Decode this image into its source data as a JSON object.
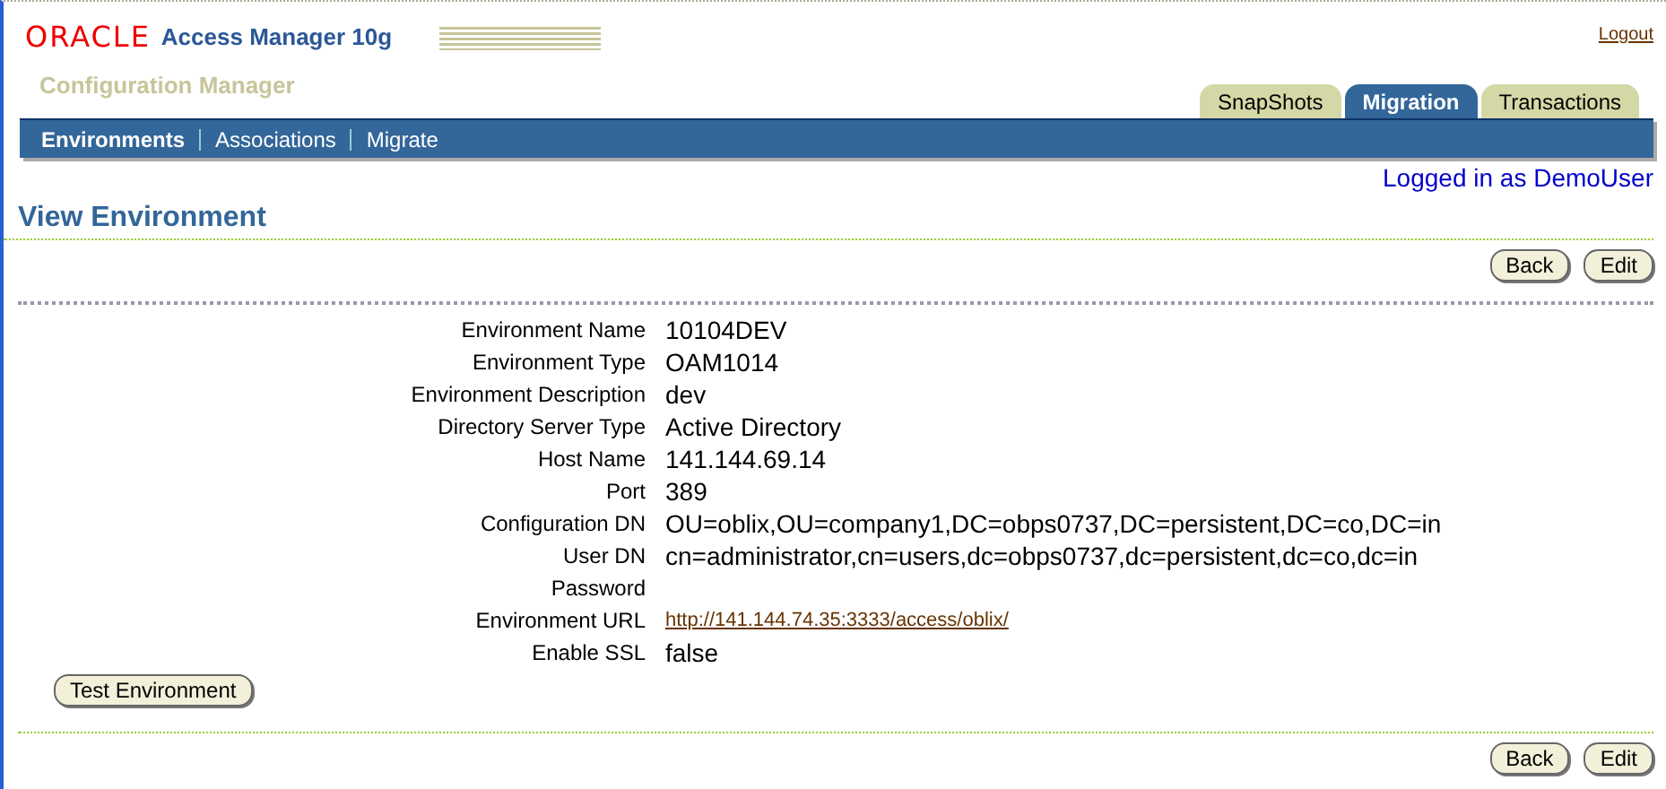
{
  "header": {
    "brand": "ORACLE",
    "product": "Access Manager 10g",
    "subtitle": "Configuration Manager",
    "logout": "Logout"
  },
  "tabs": [
    {
      "label": "SnapShots",
      "selected": false
    },
    {
      "label": "Migration",
      "selected": true
    },
    {
      "label": "Transactions",
      "selected": false
    }
  ],
  "subnav": [
    {
      "label": "Environments",
      "selected": true
    },
    {
      "label": "Associations",
      "selected": false
    },
    {
      "label": "Migrate",
      "selected": false
    }
  ],
  "logged_in": "Logged in as DemoUser",
  "page_title": "View Environment",
  "top_buttons": [
    "Back",
    "Edit"
  ],
  "fields": [
    {
      "label": "Environment Name",
      "value": "10104DEV",
      "kind": "text"
    },
    {
      "label": "Environment Type",
      "value": "OAM1014",
      "kind": "text"
    },
    {
      "label": "Environment Description",
      "value": "dev",
      "kind": "text"
    },
    {
      "label": "Directory Server Type",
      "value": "Active Directory",
      "kind": "text"
    },
    {
      "label": "Host Name",
      "value": "141.144.69.14",
      "kind": "text"
    },
    {
      "label": "Port",
      "value": "389",
      "kind": "text"
    },
    {
      "label": "Configuration DN",
      "value": "OU=oblix,OU=company1,DC=obps0737,DC=persistent,DC=co,DC=in",
      "kind": "text"
    },
    {
      "label": "User DN",
      "value": "cn=administrator,cn=users,dc=obps0737,dc=persistent,dc=co,dc=in",
      "kind": "text"
    },
    {
      "label": "Password"
    },
    {
      "label": "Environment URL",
      "value": "http://141.144.74.35:3333/access/oblix/",
      "kind": "link"
    },
    {
      "label": "Enable SSL",
      "value": "false",
      "kind": "text"
    }
  ],
  "test_button": "Test Environment",
  "bottom_buttons": [
    "Back",
    "Edit"
  ]
}
